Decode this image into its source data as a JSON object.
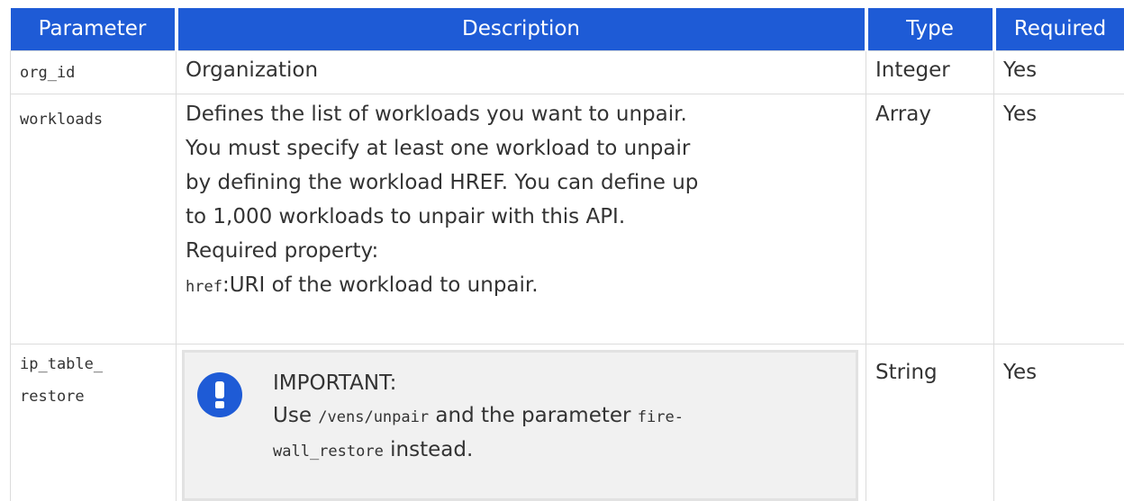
{
  "table": {
    "headers": [
      "Parameter",
      "Description",
      "Type",
      "Required"
    ],
    "rows": [
      {
        "parameter": "org_id",
        "description": "Organization",
        "type": "Integer",
        "required": "Yes"
      },
      {
        "parameter": "workloads",
        "description_lines": [
          "Defines the list of workloads you want to unpair.",
          "You must specify at least one workload to unpair",
          "by defining the workload HREF. You can define up",
          "to 1,000 workloads to unpair with this API.",
          "Required property:"
        ],
        "property_code": "href",
        "property_text": ":URI of the workload to unpair.",
        "type": "Array",
        "required": "Yes"
      },
      {
        "parameter_line1": "ip_table_",
        "parameter_line2": "restore",
        "note": {
          "icon": "exclamation-icon",
          "heading": "IMPORTANT:",
          "text_prefix": "Use ",
          "code1": "/vens/unpair",
          "text_mid": " and the parameter ",
          "code2_line1": "fire-",
          "code2_line2": "wall_restore",
          "text_suffix": " instead."
        },
        "type": "String",
        "required": "Yes"
      }
    ]
  },
  "colors": {
    "header_bg": "#1e5bd6",
    "note_bg": "#f1f1f1",
    "icon_bg": "#1e5bd6"
  }
}
